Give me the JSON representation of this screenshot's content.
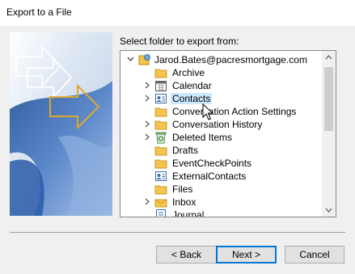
{
  "window": {
    "title": "Export to a File"
  },
  "prompt": "Select folder to export from:",
  "tree": {
    "root": "Jarod.Bates@pacresmortgage.com",
    "items": [
      {
        "label": "Archive",
        "icon": "folder-icon",
        "expandable": false
      },
      {
        "label": "Calendar",
        "icon": "calendar-icon",
        "expandable": true
      },
      {
        "label": "Contacts",
        "icon": "contacts-icon",
        "expandable": true,
        "selected": true
      },
      {
        "label": "Conversation Action Settings",
        "icon": "folder-icon",
        "expandable": false
      },
      {
        "label": "Conversation History",
        "icon": "folder-icon",
        "expandable": true
      },
      {
        "label": "Deleted Items",
        "icon": "recycle-bin-icon",
        "expandable": true
      },
      {
        "label": "Drafts",
        "icon": "folder-icon",
        "expandable": false
      },
      {
        "label": "EventCheckPoints",
        "icon": "folder-icon",
        "expandable": false
      },
      {
        "label": "ExternalContacts",
        "icon": "contacts-icon",
        "expandable": false
      },
      {
        "label": "Files",
        "icon": "folder-icon",
        "expandable": false
      },
      {
        "label": "Inbox",
        "icon": "inbox-icon",
        "expandable": true
      },
      {
        "label": "Journal",
        "icon": "journal-icon",
        "expandable": false
      }
    ]
  },
  "buttons": {
    "back": "< Back",
    "next": "Next >",
    "cancel": "Cancel"
  },
  "colors": {
    "accent": "#0078d7",
    "selection": "#cce8ff",
    "folder": "#f5c44e"
  }
}
